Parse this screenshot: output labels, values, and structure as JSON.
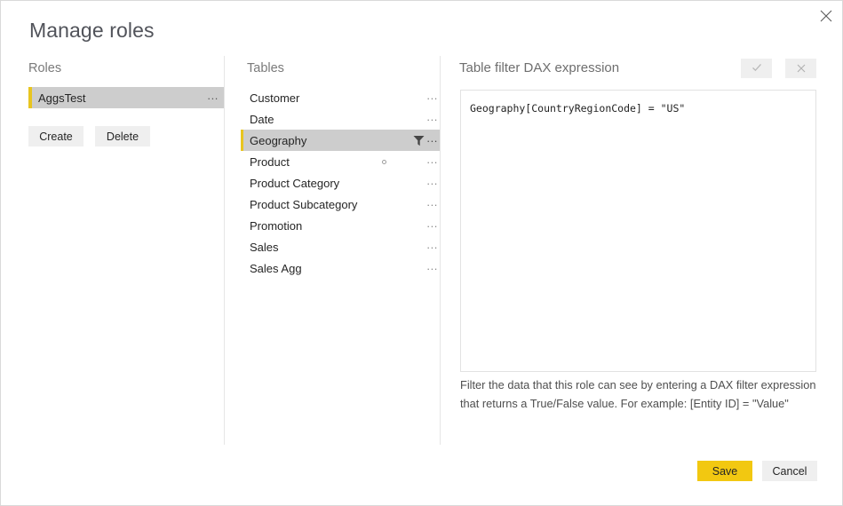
{
  "dialog": {
    "title": "Manage roles",
    "close_icon": "close-icon"
  },
  "colors": {
    "accent_yellow": "#E8C520",
    "save_yellow": "#F2C811",
    "selection_gray": "#CDCDCD",
    "button_gray": "#EFEFEF",
    "divider": "#E6E6E6",
    "title_text": "#51535A",
    "heading_text": "#7A7A7A"
  },
  "roles_panel": {
    "heading": "Roles",
    "items": [
      {
        "label": "AggsTest",
        "selected": true,
        "ellipsis": "..."
      }
    ],
    "create_label": "Create",
    "delete_label": "Delete"
  },
  "tables_panel": {
    "heading": "Tables",
    "items": [
      {
        "label": "Customer",
        "selected": false,
        "has_filter": false,
        "has_dot": false,
        "ellipsis": "..."
      },
      {
        "label": "Date",
        "selected": false,
        "has_filter": false,
        "has_dot": false,
        "ellipsis": "..."
      },
      {
        "label": "Geography",
        "selected": true,
        "has_filter": true,
        "has_dot": false,
        "ellipsis": "..."
      },
      {
        "label": "Product",
        "selected": false,
        "has_filter": false,
        "has_dot": true,
        "ellipsis": "..."
      },
      {
        "label": "Product Category",
        "selected": false,
        "has_filter": false,
        "has_dot": false,
        "ellipsis": "..."
      },
      {
        "label": "Product Subcategory",
        "selected": false,
        "has_filter": false,
        "has_dot": false,
        "ellipsis": "..."
      },
      {
        "label": "Promotion",
        "selected": false,
        "has_filter": false,
        "has_dot": false,
        "ellipsis": "..."
      },
      {
        "label": "Sales",
        "selected": false,
        "has_filter": false,
        "has_dot": false,
        "ellipsis": "..."
      },
      {
        "label": "Sales Agg",
        "selected": false,
        "has_filter": false,
        "has_dot": false,
        "ellipsis": "..."
      }
    ]
  },
  "dax_panel": {
    "heading": "Table filter DAX expression",
    "apply_icon": "checkmark-icon",
    "discard_icon": "close-icon",
    "apply_enabled": false,
    "discard_enabled": false,
    "expression": "Geography[CountryRegionCode] = \"US\"",
    "help_text": "Filter the data that this role can see by entering a DAX filter expression that returns a True/False value. For example: [Entity ID] = \"Value\""
  },
  "footer": {
    "save_label": "Save",
    "cancel_label": "Cancel"
  }
}
